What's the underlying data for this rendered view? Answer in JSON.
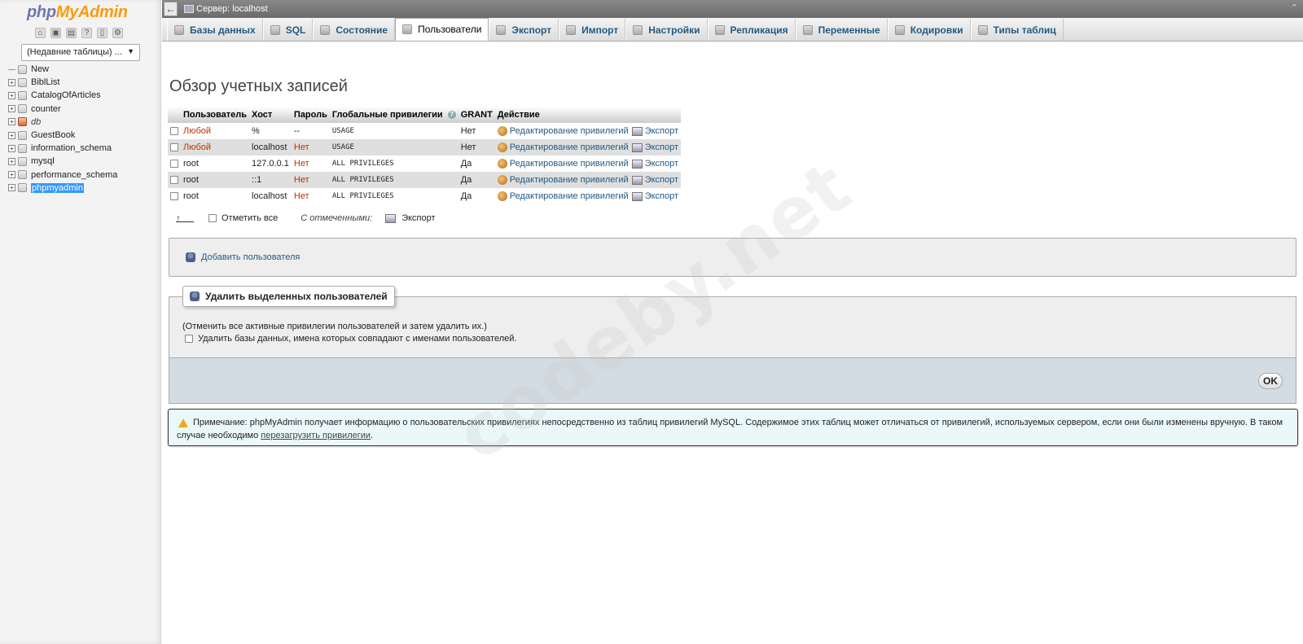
{
  "nav": {
    "logo_php": "php",
    "logo_myadmin": "MyAdmin",
    "icons": [
      "home-icon",
      "exit-icon",
      "query-icon",
      "docs-icon",
      "doc-page-icon",
      "gear-icon"
    ],
    "recent_label": "(Недавние таблицы) ...",
    "tree": [
      {
        "label": "New",
        "expandable": false,
        "style": "normal"
      },
      {
        "label": "BiblList",
        "expandable": true,
        "style": "normal"
      },
      {
        "label": "CatalogOfArticles",
        "expandable": true,
        "style": "normal"
      },
      {
        "label": "counter",
        "expandable": true,
        "style": "normal"
      },
      {
        "label": "db",
        "expandable": true,
        "style": "italic"
      },
      {
        "label": "GuestBook",
        "expandable": true,
        "style": "normal"
      },
      {
        "label": "information_schema",
        "expandable": true,
        "style": "normal"
      },
      {
        "label": "mysql",
        "expandable": true,
        "style": "normal"
      },
      {
        "label": "performance_schema",
        "expandable": true,
        "style": "normal"
      },
      {
        "label": "phpmyadmin",
        "expandable": true,
        "style": "selected"
      }
    ]
  },
  "topbar": {
    "back_glyph": "←",
    "server_label": "Сервер: localhost",
    "collapse_glyph": "⌃"
  },
  "tabs": [
    {
      "label": "Базы данных",
      "icon": "database-icon",
      "active": false
    },
    {
      "label": "SQL",
      "icon": "sql-icon",
      "active": false
    },
    {
      "label": "Состояние",
      "icon": "status-icon",
      "active": false
    },
    {
      "label": "Пользователи",
      "icon": "users-icon",
      "active": true
    },
    {
      "label": "Экспорт",
      "icon": "export-icon",
      "active": false
    },
    {
      "label": "Импорт",
      "icon": "import-icon",
      "active": false
    },
    {
      "label": "Настройки",
      "icon": "wrench-icon",
      "active": false
    },
    {
      "label": "Репликация",
      "icon": "replication-icon",
      "active": false
    },
    {
      "label": "Переменные",
      "icon": "variables-icon",
      "active": false
    },
    {
      "label": "Кодировки",
      "icon": "charset-icon",
      "active": false
    },
    {
      "label": "Типы таблиц",
      "icon": "engines-icon",
      "active": false
    }
  ],
  "page": {
    "title": "Обзор учетных записей"
  },
  "users_table": {
    "headers": {
      "user": "Пользователь",
      "host": "Хост",
      "password": "Пароль",
      "global_privileges": "Глобальные привилегии",
      "grant": "GRANT",
      "action": "Действие"
    },
    "edit_label": "Редактирование привилегий",
    "export_label": "Экспорт",
    "rows": [
      {
        "user": "Любой",
        "user_red": true,
        "host": "%",
        "password": "--",
        "password_red": false,
        "privileges": "USAGE",
        "grant": "Нет"
      },
      {
        "user": "Любой",
        "user_red": true,
        "host": "localhost",
        "password": "Нет",
        "password_red": true,
        "privileges": "USAGE",
        "grant": "Нет"
      },
      {
        "user": "root",
        "user_red": false,
        "host": "127.0.0.1",
        "password": "Нет",
        "password_red": true,
        "privileges": "ALL PRIVILEGES",
        "grant": "Да"
      },
      {
        "user": "root",
        "user_red": false,
        "host": "::1",
        "password": "Нет",
        "password_red": true,
        "privileges": "ALL PRIVILEGES",
        "grant": "Да"
      },
      {
        "user": "root",
        "user_red": false,
        "host": "localhost",
        "password": "Нет",
        "password_red": true,
        "privileges": "ALL PRIVILEGES",
        "grant": "Да"
      }
    ]
  },
  "bulk": {
    "check_all_label": "Отметить все",
    "with_selected_label": "С отмеченными:",
    "export_label": "Экспорт"
  },
  "add_user": {
    "label": "Добавить пользователя"
  },
  "delete_users": {
    "legend": "Удалить выделенных пользователей",
    "note": "(Отменить все активные привилегии пользователей и затем удалить их.)",
    "drop_db_label": "Удалить базы данных, имена которых совпадают с именами пользователей.",
    "ok_label": "OK"
  },
  "notice": {
    "text": "Примечание: phpMyAdmin получает информацию о пользовательских привилегиях непосредственно из таблиц привилегий MySQL. Содержимое этих таблиц может отличаться от привилегий, используемых сервером, если они были изменены вручную. В таком случае необходимо ",
    "link_label": "перезагрузить привилегии",
    "tail": "."
  },
  "watermark": "codeby.net",
  "colors": {
    "link": "#235a81",
    "red_value": "#bb3300",
    "selected_db": "#3399ff",
    "notice_bg": "#ebf8fa"
  }
}
